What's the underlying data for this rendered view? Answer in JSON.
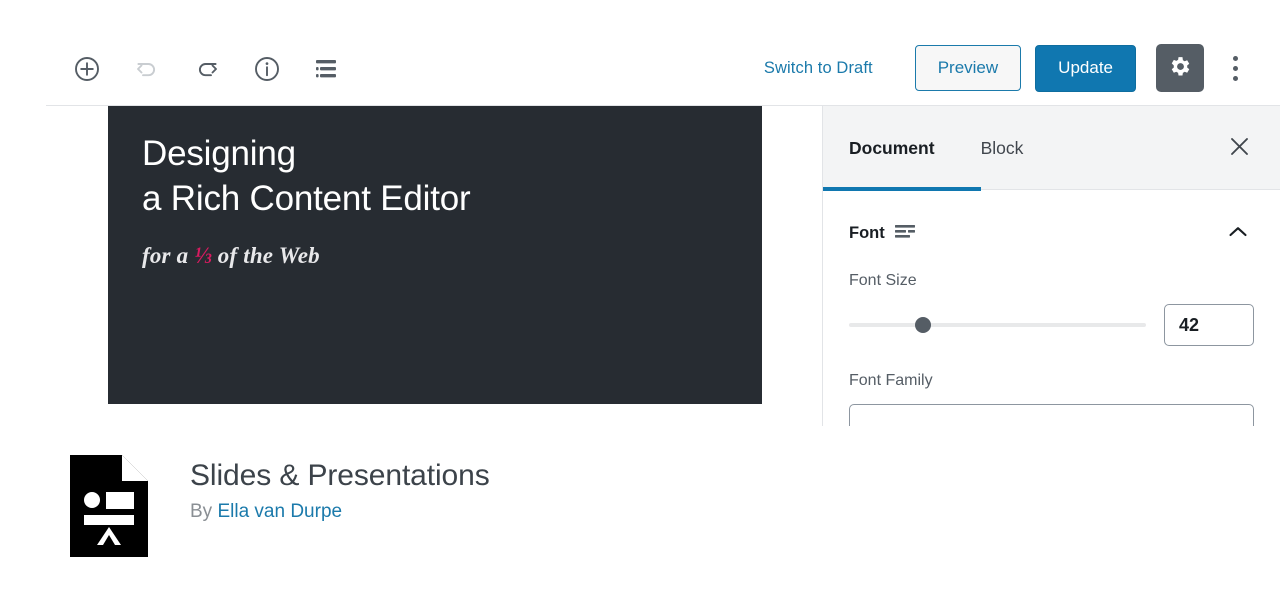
{
  "toolbar": {
    "left_tools": [
      {
        "name": "add-block-icon",
        "label": "Add block",
        "disabled": false
      },
      {
        "name": "undo-icon",
        "label": "Undo",
        "disabled": true
      },
      {
        "name": "redo-icon",
        "label": "Redo",
        "disabled": false
      },
      {
        "name": "info-icon",
        "label": "Content structure",
        "disabled": false
      },
      {
        "name": "block-navigation-icon",
        "label": "Block navigation",
        "disabled": false
      }
    ],
    "switch_to_draft_label": "Switch to Draft",
    "preview_label": "Preview",
    "update_label": "Update",
    "settings_icon": "gear-icon",
    "more_menu_icon": "kebab-menu-icon"
  },
  "slide": {
    "title": "Designing\na Rich Content Editor",
    "subtitle_before": "for a ",
    "subtitle_fraction": "⅓",
    "subtitle_after": " of the Web",
    "background_color": "#272c32",
    "title_color": "#ffffff",
    "fraction_color": "#d81b60"
  },
  "panel": {
    "tabs": [
      {
        "label": "Document",
        "active": true
      },
      {
        "label": "Block",
        "active": false
      }
    ],
    "close_icon": "close-icon",
    "section": {
      "title": "Font",
      "icon": "text-lines-icon",
      "toggle_icon": "chevron-up-icon",
      "expanded": true
    },
    "font_size": {
      "label": "Font Size",
      "value": "42",
      "slider_percent": 25
    },
    "font_family": {
      "label": "Font Family",
      "value": ""
    },
    "accent_color": "#1077b0"
  },
  "footer": {
    "icon": "presentation-document-icon",
    "title": "Slides & Presentations",
    "by_prefix": "By ",
    "author": "Ella van Durpe",
    "author_link_color": "#1b7aab"
  }
}
